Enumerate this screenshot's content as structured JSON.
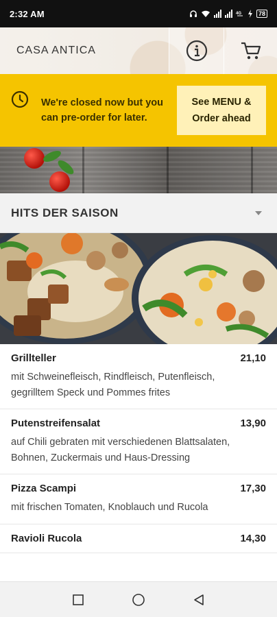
{
  "status_bar": {
    "time": "2:32 AM",
    "icons": [
      "headphones-icon",
      "wifi-icon",
      "signal-icon",
      "signal-icon",
      "data-4g-icon",
      "charging-icon",
      "battery-icon"
    ],
    "battery_level": "78"
  },
  "header": {
    "brand": "CASA ANTICA",
    "info_icon": "info-icon",
    "cart_icon": "cart-icon"
  },
  "closed_banner": {
    "message": "We're closed now but you can pre-order for later.",
    "button_line1": "See MENU &",
    "button_line2": "Order ahead",
    "color": "#f5c400"
  },
  "category": {
    "title": "HITS DER SAISON",
    "toggle_icon": "chevron-down-icon"
  },
  "menu": {
    "items": [
      {
        "name": "Grillteller",
        "price": "21,10",
        "description": "mit Schweinefleisch, Rindfleisch, Putenfleisch, gegrilltem Speck und Pommes frites"
      },
      {
        "name": "Putenstreifensalat",
        "price": "13,90",
        "description": "auf Chili gebraten mit verschiedenen Blattsalaten, Bohnen, Zuckermais und Haus-Dressing"
      },
      {
        "name": "Pizza Scampi",
        "price": "17,30",
        "description": "mit frischen Tomaten, Knoblauch und Rucola"
      },
      {
        "name": "Ravioli Rucola",
        "price": "14,30",
        "description": ""
      }
    ]
  },
  "navbar": {
    "recents_icon": "square-icon",
    "home_icon": "circle-icon",
    "back_icon": "triangle-back-icon"
  }
}
